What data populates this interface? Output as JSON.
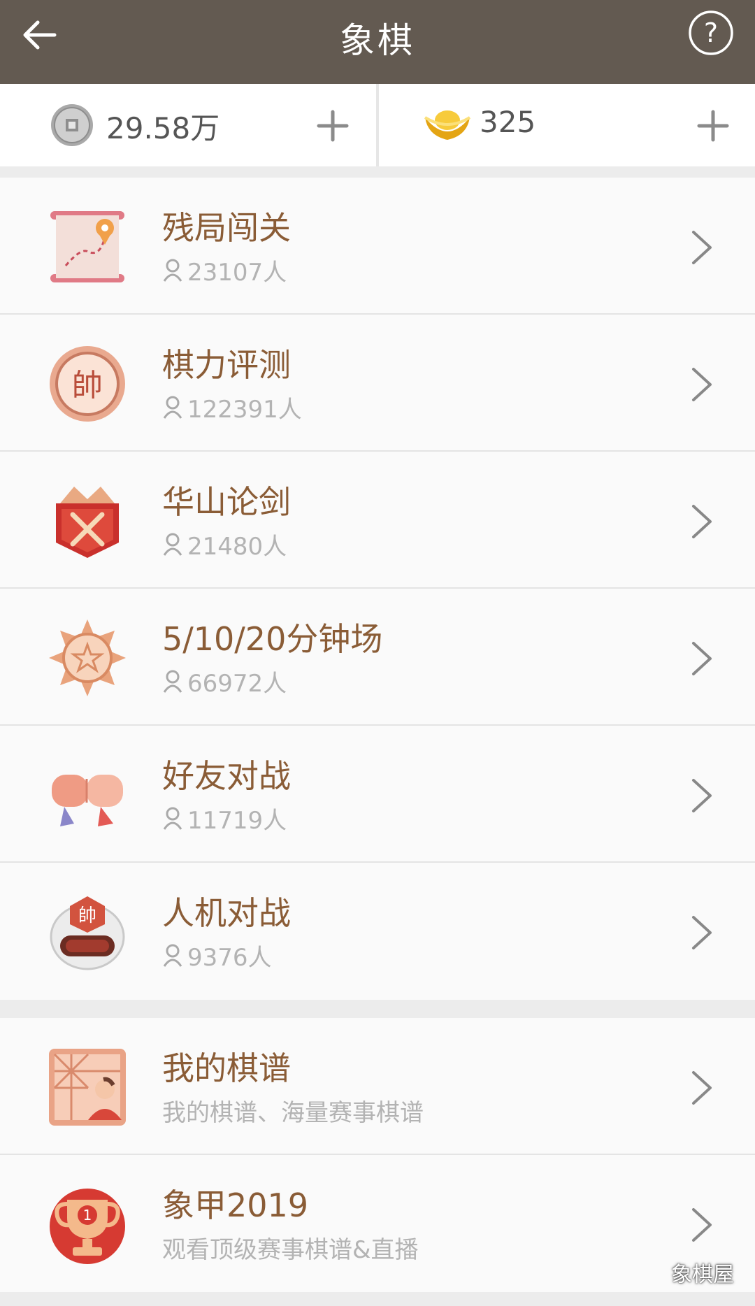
{
  "header": {
    "title": "象棋",
    "back_icon": "arrow-left-icon",
    "help_icon": "question-circle-icon"
  },
  "currency": {
    "coins": {
      "value": "29.58万",
      "icon": "copper-coin-icon"
    },
    "ingots": {
      "value": "325",
      "icon": "gold-ingot-icon"
    }
  },
  "modes": [
    {
      "name": "残局闯关",
      "count": "23107人",
      "icon": "scroll-map-icon"
    },
    {
      "name": "棋力评测",
      "count": "122391人",
      "icon": "shuai-piece-icon"
    },
    {
      "name": "华山论剑",
      "count": "21480人",
      "icon": "crossed-swords-shield-icon"
    },
    {
      "name": "5/10/20分钟场",
      "count": "66972人",
      "icon": "star-medal-icon"
    },
    {
      "name": "好友对战",
      "count": "11719人",
      "icon": "fist-bump-icon"
    },
    {
      "name": "人机对战",
      "count": "9376人",
      "icon": "robot-helmet-icon"
    }
  ],
  "extras": [
    {
      "name": "我的棋谱",
      "desc": "我的棋谱、海量赛事棋谱",
      "icon": "chess-record-icon"
    },
    {
      "name": "象甲2019",
      "desc": "观看顶级赛事棋谱&直播",
      "icon": "trophy-icon"
    }
  ],
  "watermark": "象棋屋",
  "colors": {
    "header_bg": "#635a51",
    "item_title": "#8a5c36",
    "item_sub": "#b3b3b3"
  }
}
